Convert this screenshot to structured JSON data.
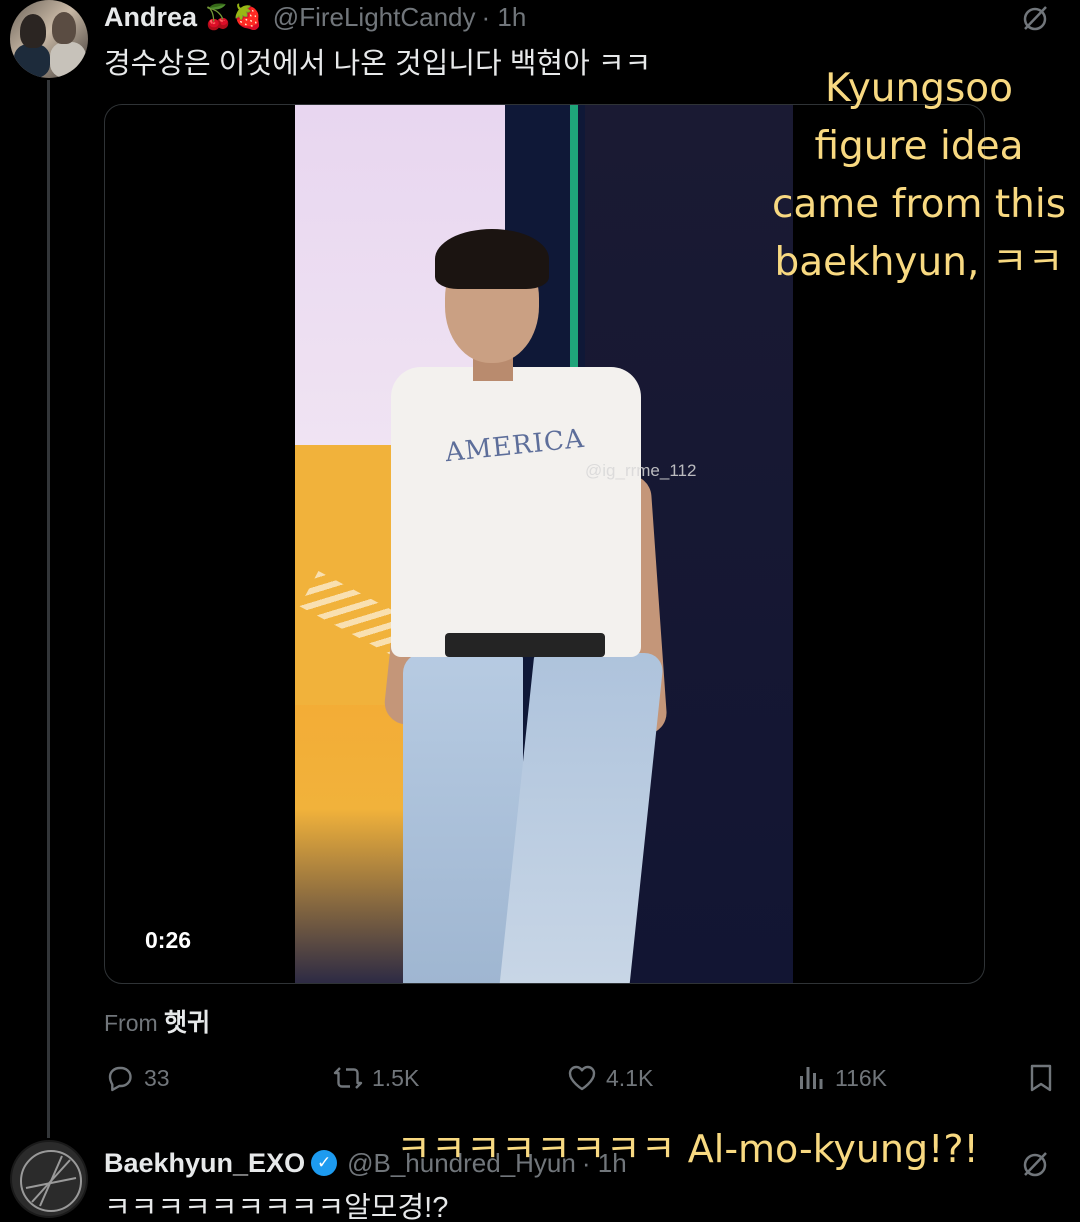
{
  "top_tweet": {
    "display_name": "Andrea",
    "name_emojis": "🍒🍓",
    "handle": "@FireLightCandy",
    "time": "· 1h",
    "text": "경수상은 이것에서 나온 것입니다 백현아 ㅋㅋ",
    "media": {
      "duration": "0:26",
      "shirt_text": "AMERICA",
      "watermark": "@ig_rrme_112"
    },
    "from_prefix": "From",
    "from_source": "햇귀",
    "actions": {
      "replies": "33",
      "retweets": "1.5K",
      "likes": "4.1K",
      "views": "116K"
    }
  },
  "reply_tweet": {
    "display_name": "Baekhyun_EXO",
    "handle": "@B_hundred_Hyun",
    "time": "· 1h",
    "text": "ㅋㅋㅋㅋㅋㅋㅋㅋㅋ알모경!?"
  },
  "captions": {
    "translation_lines": [
      "Kyungsoo",
      "figure idea",
      "came from this",
      "baekhyun, ㅋㅋ"
    ],
    "reply_translation": "ㅋㅋㅋㅋㅋㅋㅋㅋ Al-mo-kyung!?!"
  },
  "colors": {
    "background": "#000000",
    "text_primary": "#e7e9ea",
    "text_secondary": "#71767b",
    "verified": "#1d9bf0",
    "caption": "#f8d981"
  },
  "icons": [
    "grok-icon",
    "reply-icon",
    "retweet-icon",
    "like-icon",
    "views-icon",
    "bookmark-icon",
    "verified-badge-icon"
  ]
}
